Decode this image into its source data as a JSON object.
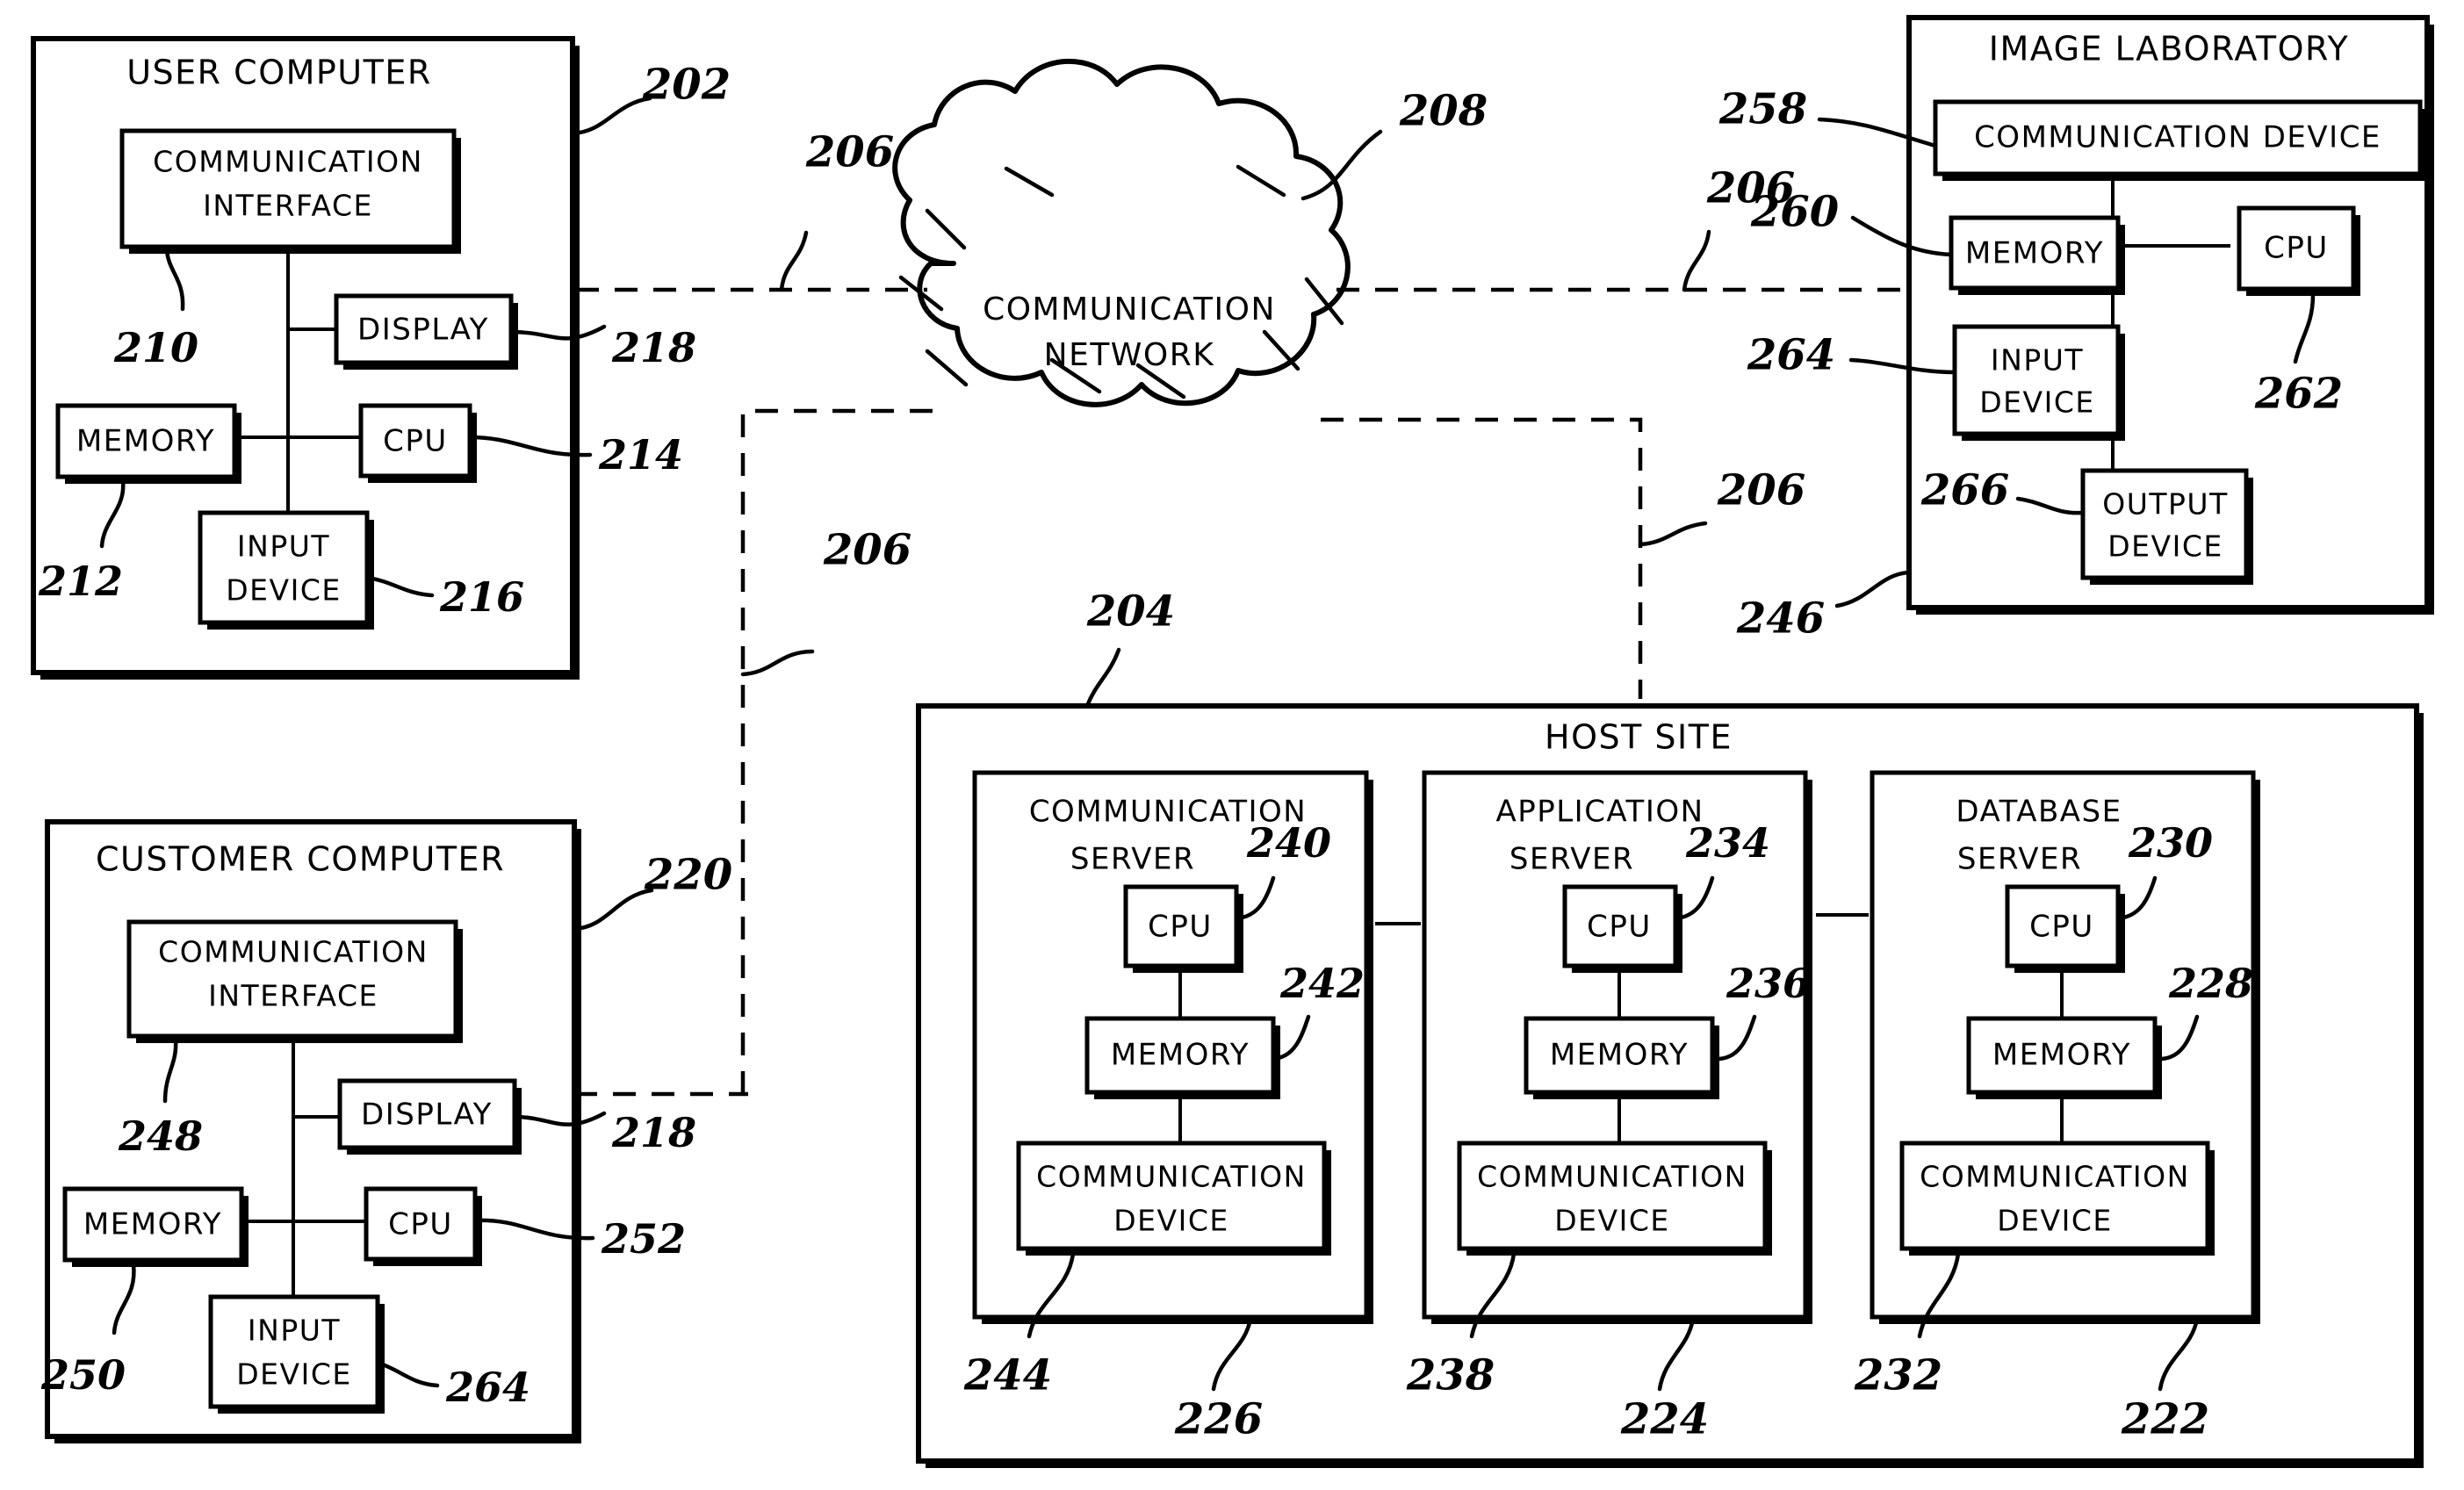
{
  "figure": {
    "type": "patent-block-diagram",
    "background_color": "#ffffff",
    "line_color": "#000000"
  },
  "panels": {
    "user_computer": {
      "title": "USER COMPUTER",
      "ref": "202",
      "blocks": {
        "communication_interface": {
          "label_line1": "COMMUNICATION",
          "label_line2": "INTERFACE",
          "ref": "210"
        },
        "display": {
          "label": "DISPLAY",
          "ref": "218"
        },
        "memory": {
          "label": "MEMORY",
          "ref": "212"
        },
        "cpu": {
          "label": "CPU",
          "ref": "214"
        },
        "input_device": {
          "label_line1": "INPUT",
          "label_line2": "DEVICE",
          "ref": "216"
        }
      }
    },
    "customer_computer": {
      "title": "CUSTOMER COMPUTER",
      "ref": "220",
      "blocks": {
        "communication_interface": {
          "label_line1": "COMMUNICATION",
          "label_line2": "INTERFACE",
          "ref": "248"
        },
        "display": {
          "label": "DISPLAY",
          "ref": "218"
        },
        "memory": {
          "label": "MEMORY",
          "ref": "250"
        },
        "cpu": {
          "label": "CPU",
          "ref": "252"
        },
        "input_device": {
          "label_line1": "INPUT",
          "label_line2": "DEVICE",
          "ref": "264"
        }
      }
    },
    "image_laboratory": {
      "title": "IMAGE LABORATORY",
      "ref": "246",
      "blocks": {
        "communication_device": {
          "label": "COMMUNICATION DEVICE",
          "ref": "258"
        },
        "memory": {
          "label": "MEMORY",
          "ref": "260"
        },
        "cpu": {
          "label": "CPU",
          "ref": "262"
        },
        "input_device": {
          "label_line1": "INPUT",
          "label_line2": "DEVICE",
          "ref": "264"
        },
        "output_device": {
          "label_line1": "OUTPUT",
          "label_line2": "DEVICE",
          "ref": "266"
        }
      }
    },
    "host_site": {
      "title": "HOST SITE",
      "ref": "204",
      "servers": [
        {
          "name_line1": "COMMUNICATION",
          "name_line2": "SERVER",
          "ref": "226",
          "cpu": {
            "label": "CPU",
            "ref": "240"
          },
          "memory": {
            "label": "MEMORY",
            "ref": "242"
          },
          "communication_device": {
            "label_line1": "COMMUNICATION",
            "label_line2": "DEVICE",
            "ref": "244"
          }
        },
        {
          "name_line1": "APPLICATION",
          "name_line2": "SERVER",
          "ref": "224",
          "cpu": {
            "label": "CPU",
            "ref": "234"
          },
          "memory": {
            "label": "MEMORY",
            "ref": "236"
          },
          "communication_device": {
            "label_line1": "COMMUNICATION",
            "label_line2": "DEVICE",
            "ref": "238"
          }
        },
        {
          "name_line1": "DATABASE",
          "name_line2": "SERVER",
          "ref": "222",
          "cpu": {
            "label": "CPU",
            "ref": "230"
          },
          "memory": {
            "label": "MEMORY",
            "ref": "228"
          },
          "communication_device": {
            "label_line1": "COMMUNICATION",
            "label_line2": "DEVICE",
            "ref": "232"
          }
        }
      ]
    },
    "network": {
      "title_line1": "COMMUNICATION",
      "title_line2": "NETWORK",
      "ref": "208"
    }
  },
  "link_refs": {
    "user_to_network": "206",
    "network_to_lab": "206",
    "host_to_network": "206",
    "lab_lower": "206"
  }
}
